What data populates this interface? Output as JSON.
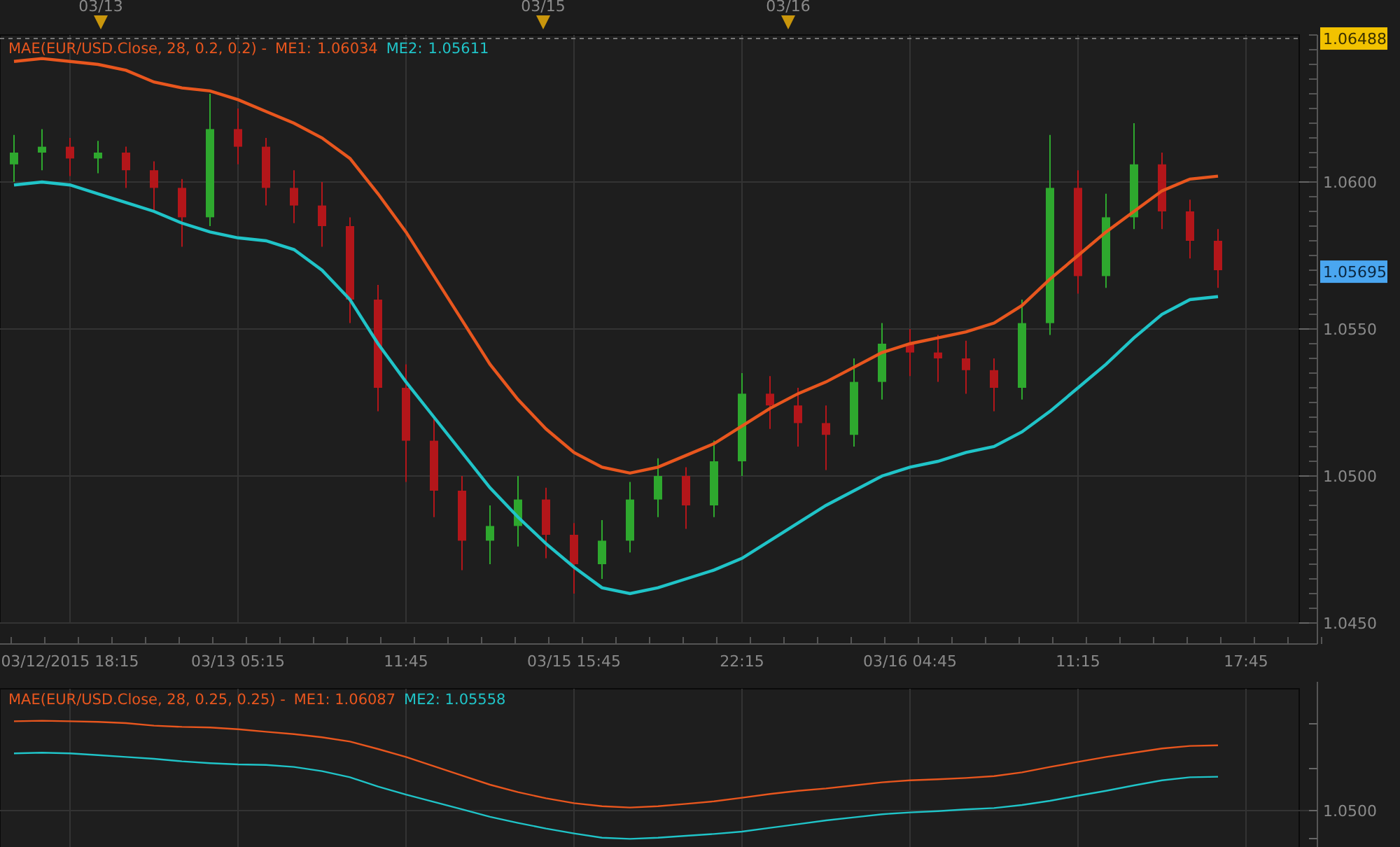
{
  "main_panel": {
    "legend": {
      "study": "MAE(EUR/USD.Close, 28, 0.2, 0.2) -",
      "me1": "1.06034",
      "me2": "1.05611"
    },
    "last_badge": "1.05695",
    "chart_data": {
      "type": "line",
      "ylim": [
        1.045,
        1.065
      ],
      "grid": true,
      "ref_lines": [
        {
          "axis": "y",
          "value": 1.06488,
          "label": "1.06488"
        }
      ],
      "annotations": [
        "03/13",
        "03/15",
        "03/16"
      ],
      "categories": [
        null,
        null,
        "03/12/2015 18:15",
        null,
        null,
        null,
        null,
        null,
        "03/13 05:15",
        null,
        null,
        null,
        null,
        null,
        "11:45",
        null,
        null,
        null,
        null,
        null,
        "03/15 15:45",
        null,
        null,
        null,
        null,
        null,
        "22:15",
        null,
        null,
        null,
        null,
        null,
        "03/16 04:45",
        null,
        null,
        null,
        null,
        null,
        "11:15",
        null,
        null,
        null,
        null,
        null,
        "17:45"
      ],
      "yticks": [
        {
          "value": 1.045,
          "label": "1.0450"
        },
        {
          "value": 1.05,
          "label": "1.0500"
        },
        {
          "value": 1.055,
          "label": "1.0550"
        },
        {
          "value": 1.06,
          "label": "1.0600"
        }
      ],
      "series": [
        {
          "name": "ME1:",
          "color": "#e8561e",
          "values": [
            1.0641,
            1.0642,
            1.0641,
            1.064,
            1.0638,
            1.0634,
            1.0632,
            1.0631,
            1.0628,
            1.0624,
            1.062,
            1.0615,
            1.0608,
            1.0596,
            1.0583,
            1.0568,
            1.0553,
            1.0538,
            1.0526,
            1.0516,
            1.0508,
            1.0503,
            1.0501,
            1.0503,
            1.0507,
            1.0511,
            1.0517,
            1.0523,
            1.0528,
            1.0532,
            1.0537,
            1.0542,
            1.0545,
            1.0547,
            1.0549,
            1.0552,
            1.0558,
            1.0567,
            1.0575,
            1.0583,
            1.059,
            1.0597,
            1.0601,
            1.0602,
            null
          ]
        },
        {
          "name": "ME2:",
          "color": "#20c4c8",
          "values": [
            1.0599,
            1.06,
            1.0599,
            1.0596,
            1.0593,
            1.059,
            1.0586,
            1.0583,
            1.0581,
            1.058,
            1.0577,
            1.057,
            1.056,
            1.0545,
            1.0532,
            1.052,
            1.0508,
            1.0496,
            1.0486,
            1.0477,
            1.0469,
            1.0462,
            1.046,
            1.0462,
            1.0465,
            1.0468,
            1.0472,
            1.0478,
            1.0484,
            1.049,
            1.0495,
            1.05,
            1.0503,
            1.0505,
            1.0508,
            1.051,
            1.0515,
            1.0522,
            1.053,
            1.0538,
            1.0547,
            1.0555,
            1.056,
            1.0561,
            null
          ]
        }
      ]
    },
    "candles": {
      "chart_data": {
        "type": "candlestick",
        "ylim": [
          1.045,
          1.065
        ],
        "ohlc": [
          [
            1.0606,
            1.0616,
            1.06,
            1.061
          ],
          [
            1.061,
            1.0618,
            1.0604,
            1.0612
          ],
          [
            1.0612,
            1.0615,
            1.0602,
            1.0608
          ],
          [
            1.0608,
            1.0614,
            1.0603,
            1.061
          ],
          [
            1.061,
            1.0612,
            1.0598,
            1.0604
          ],
          [
            1.0604,
            1.0607,
            1.059,
            1.0598
          ],
          [
            1.0598,
            1.0601,
            1.0578,
            1.0588
          ],
          [
            1.0588,
            1.063,
            1.0585,
            1.0618
          ],
          [
            1.0618,
            1.0625,
            1.0606,
            1.0612
          ],
          [
            1.0612,
            1.0615,
            1.0592,
            1.0598
          ],
          [
            1.0598,
            1.0604,
            1.0586,
            1.0592
          ],
          [
            1.0592,
            1.06,
            1.0578,
            1.0585
          ],
          [
            1.0585,
            1.0588,
            1.0552,
            1.056
          ],
          [
            1.056,
            1.0565,
            1.0522,
            1.053
          ],
          [
            1.053,
            1.0538,
            1.0498,
            1.0512
          ],
          [
            1.0512,
            1.052,
            1.0486,
            1.0495
          ],
          [
            1.0495,
            1.05,
            1.0468,
            1.0478
          ],
          [
            1.0478,
            1.049,
            1.047,
            1.0483
          ],
          [
            1.0483,
            1.05,
            1.0476,
            1.0492
          ],
          [
            1.0492,
            1.0496,
            1.0472,
            1.048
          ],
          [
            1.048,
            1.0484,
            1.046,
            1.047
          ],
          [
            1.047,
            1.0485,
            1.0465,
            1.0478
          ],
          [
            1.0478,
            1.0498,
            1.0474,
            1.0492
          ],
          [
            1.0492,
            1.0506,
            1.0486,
            1.05
          ],
          [
            1.05,
            1.0503,
            1.0482,
            1.049
          ],
          [
            1.049,
            1.0512,
            1.0486,
            1.0505
          ],
          [
            1.0505,
            1.0535,
            1.05,
            1.0528
          ],
          [
            1.0528,
            1.0534,
            1.0516,
            1.0524
          ],
          [
            1.0524,
            1.053,
            1.051,
            1.0518
          ],
          [
            1.0518,
            1.0524,
            1.0502,
            1.0514
          ],
          [
            1.0514,
            1.054,
            1.051,
            1.0532
          ],
          [
            1.0532,
            1.0552,
            1.0526,
            1.0545
          ],
          [
            1.0545,
            1.055,
            1.0534,
            1.0542
          ],
          [
            1.0542,
            1.0548,
            1.0532,
            1.054
          ],
          [
            1.054,
            1.0546,
            1.0528,
            1.0536
          ],
          [
            1.0536,
            1.054,
            1.0522,
            1.053
          ],
          [
            1.053,
            1.056,
            1.0526,
            1.0552
          ],
          [
            1.0552,
            1.0616,
            1.0548,
            1.0598
          ],
          [
            1.0598,
            1.0604,
            1.0562,
            1.0568
          ],
          [
            1.0568,
            1.0596,
            1.0564,
            1.0588
          ],
          [
            1.0588,
            1.062,
            1.0584,
            1.0606
          ],
          [
            1.0606,
            1.061,
            1.0584,
            1.059
          ],
          [
            1.059,
            1.0594,
            1.0574,
            1.058
          ],
          [
            1.058,
            1.0584,
            1.0564,
            1.057
          ],
          null
        ]
      }
    }
  },
  "lower_panel": {
    "legend": {
      "study": "MAE(EUR/USD.Close, 28, 0.25, 0.25) -",
      "me1": "ME1: 1.06087",
      "me2": "ME2: 1.05558"
    },
    "axis_label": "1.0500"
  }
}
